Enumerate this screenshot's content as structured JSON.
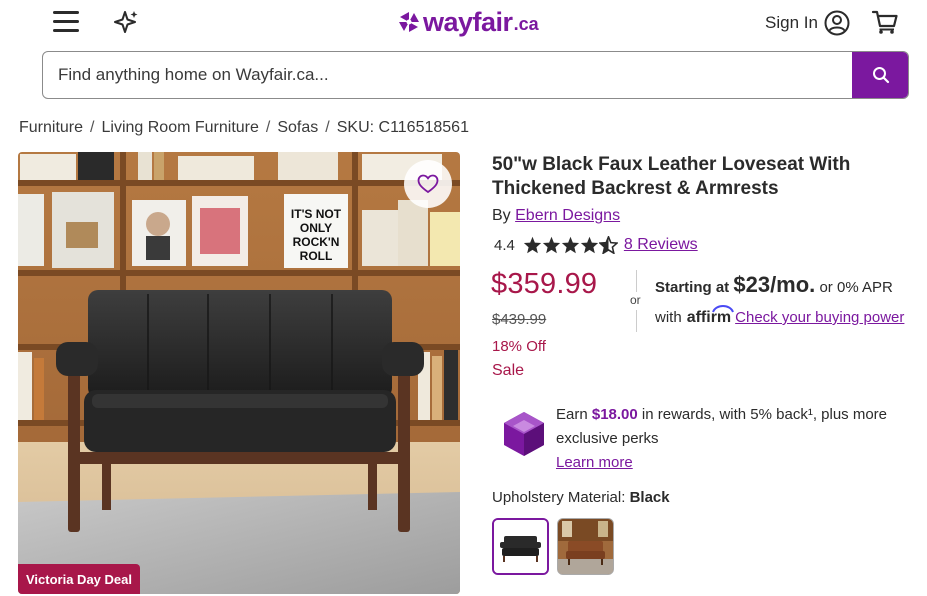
{
  "header": {
    "logo_text": "wayfair",
    "logo_suffix": ".ca",
    "sign_in_label": "Sign In",
    "icons": [
      "menu-icon",
      "sparkle-icon",
      "account-icon",
      "cart-icon"
    ],
    "brand_color": "#7b189f"
  },
  "search": {
    "placeholder": "Find anything home on Wayfair.ca...",
    "value": ""
  },
  "breadcrumb": {
    "items": [
      "Furniture",
      "Living Room Furniture",
      "Sofas"
    ],
    "sku": "SKU: C116518561"
  },
  "product": {
    "badge": "Victoria Day Deal",
    "title": "50\"w Black Faux Leather Loveseat With Thickened Backrest & Armrests",
    "by_label": "By",
    "brand": "Ebern Designs",
    "rating_value": "4.4",
    "rating": 4.4,
    "reviews_label": "8 Reviews",
    "price": "$359.99",
    "original_price": "$439.99",
    "discount": "18% Off",
    "sale_label": "Sale",
    "sale_color": "#a8174a"
  },
  "financing": {
    "or_label": "or",
    "starting_label": "Starting at",
    "monthly_amount": "$23/mo.",
    "apr_text": "or 0% APR",
    "with_label": "with",
    "affirm_label": "affirm",
    "check_power_link": "Check your buying power"
  },
  "rewards": {
    "earn_prefix": "Earn",
    "amount": "$18.00",
    "earn_suffix": "in rewards, with 5% back¹, plus more exclusive perks",
    "learn_more": "Learn more"
  },
  "options": {
    "label": "Upholstery Material:",
    "selected": "Black"
  }
}
